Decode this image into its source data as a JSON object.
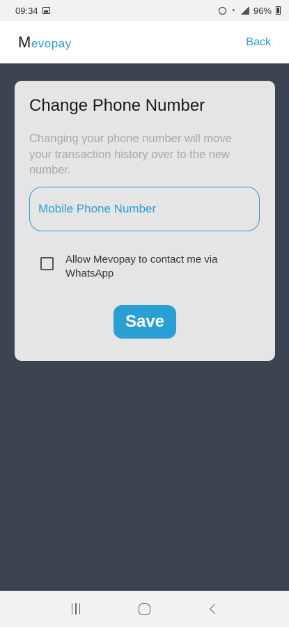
{
  "status_bar": {
    "time": "09:34",
    "battery": "96%",
    "icons": [
      "image-icon",
      "alarm-icon",
      "wifi-icon",
      "signal-icon",
      "battery-icon"
    ]
  },
  "app_bar": {
    "logo_initial": "M",
    "logo_rest": "evopay",
    "back_label": "Back"
  },
  "card": {
    "title": "Change Phone Number",
    "description": "Changing your phone number will move your transaction history over to the new number.",
    "phone_placeholder": "Mobile Phone Number",
    "phone_value": "",
    "whatsapp_label": "Allow Mevopay to contact me via WhatsApp",
    "whatsapp_checked": false,
    "save_label": "Save"
  },
  "colors": {
    "accent": "#2a9fd6",
    "background": "#3b4450",
    "card": "#e5e5e5"
  },
  "nav_bar": {
    "icons": [
      "recents-icon",
      "home-icon",
      "back-icon"
    ]
  }
}
